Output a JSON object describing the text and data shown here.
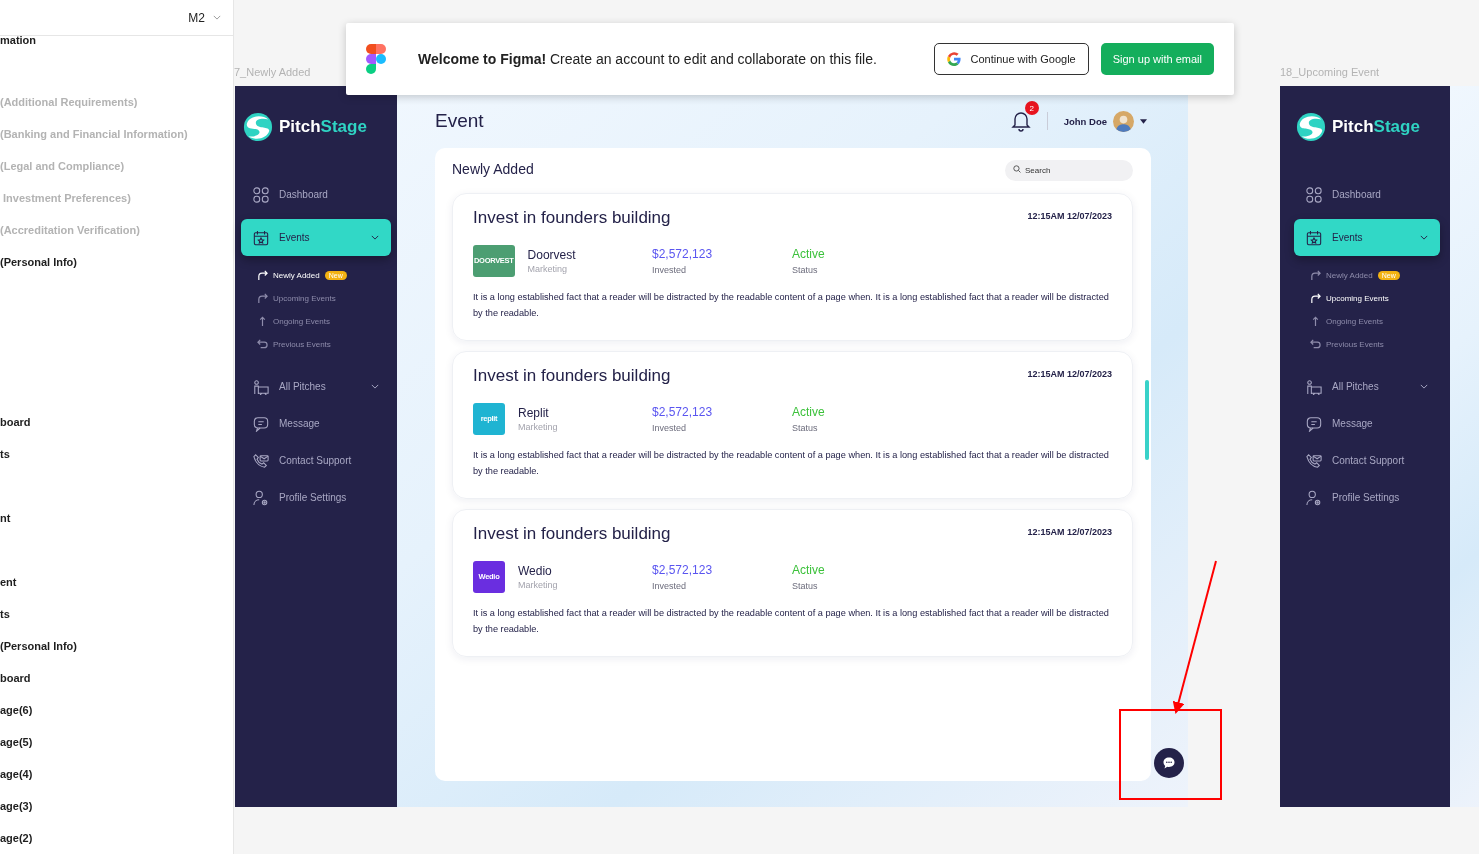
{
  "layers_panel": {
    "page_selector": "M2",
    "layers": [
      {
        "text": "mation",
        "greyed": false
      },
      {
        "text": "(Additional Requirements)",
        "greyed": true
      },
      {
        "text": "(Banking and Financial Information)",
        "greyed": true
      },
      {
        "text": "(Legal and Compliance)",
        "greyed": true
      },
      {
        "text": " Investment Preferences)",
        "greyed": true
      },
      {
        "text": "(Accreditation Verification)",
        "greyed": true
      },
      {
        "text": "(Personal Info)",
        "greyed": false
      },
      {
        "text": "board",
        "greyed": false
      },
      {
        "text": "ts",
        "greyed": false
      },
      {
        "text": "nt",
        "greyed": false
      },
      {
        "text": "ent",
        "greyed": false
      },
      {
        "text": "ts",
        "greyed": false
      },
      {
        "text": "(Personal Info)",
        "greyed": false
      },
      {
        "text": "board",
        "greyed": false
      },
      {
        "text": "age(6)",
        "greyed": false
      },
      {
        "text": "age(5)",
        "greyed": false
      },
      {
        "text": "age(4)",
        "greyed": false
      },
      {
        "text": "age(3)",
        "greyed": false
      },
      {
        "text": "age(2)",
        "greyed": false
      }
    ]
  },
  "frames": [
    {
      "label": "7_Newly Added",
      "sidebar": {
        "brand": [
          "Pitch",
          "Stage"
        ],
        "items": [
          {
            "kind": "dashboard",
            "label": "Dashboard",
            "selected": false
          },
          {
            "kind": "events",
            "label": "Events",
            "selected": true,
            "children": [
              {
                "kind": "forward",
                "label": "Newly Added",
                "badge": "New",
                "selected": true
              },
              {
                "kind": "forward",
                "label": "Upcoming Events",
                "selected": false
              },
              {
                "kind": "up",
                "label": "Ongoing Events",
                "selected": false
              },
              {
                "kind": "back",
                "label": "Previous Events",
                "selected": false
              }
            ]
          },
          {
            "kind": "pitches",
            "label": "All Pitches",
            "selected": false,
            "dropdown": true
          },
          {
            "kind": "message",
            "label": "Message",
            "selected": false
          },
          {
            "kind": "support",
            "label": "Contact Support",
            "selected": false
          },
          {
            "kind": "profile",
            "label": "Profile Settings",
            "selected": false
          }
        ]
      }
    },
    {
      "label": "18_Upcoming Event",
      "sidebar": {
        "brand": [
          "Pitch",
          "Stage"
        ],
        "items": [
          {
            "kind": "dashboard",
            "label": "Dashboard",
            "selected": false
          },
          {
            "kind": "events",
            "label": "Events",
            "selected": true,
            "children": [
              {
                "kind": "forward",
                "label": "Newly Added",
                "badge": "New",
                "selected": false
              },
              {
                "kind": "forward",
                "label": "Upcoming Events",
                "selected": true
              },
              {
                "kind": "up",
                "label": "Ongoing Events",
                "selected": false
              },
              {
                "kind": "back",
                "label": "Previous Events",
                "selected": false
              }
            ]
          },
          {
            "kind": "pitches",
            "label": "All Pitches",
            "selected": false,
            "dropdown": true
          },
          {
            "kind": "message",
            "label": "Message",
            "selected": false
          },
          {
            "kind": "support",
            "label": "Contact Support",
            "selected": false
          },
          {
            "kind": "profile",
            "label": "Profile Settings",
            "selected": false
          }
        ]
      }
    }
  ],
  "event_page": {
    "title": "Event",
    "notifications": "2",
    "user": "John Doe",
    "panel_title": "Newly Added",
    "search": {
      "placeholder": "Search"
    },
    "events": [
      {
        "title": "Invest in founders building",
        "time": "12:15AM 12/07/2023",
        "company": "Doorvest",
        "category": "Marketing",
        "logo_text": "DOORVEST",
        "color": "#4c9e72",
        "amount": "$2,572,123",
        "amount_label": "Invested",
        "status": "Active",
        "status_label": "Status",
        "description": "It is a long established fact that a reader will be distracted by the readable content of a page when. It is a long  established fact that a reader will be distracted by the readable."
      },
      {
        "title": "Invest in founders building",
        "time": "12:15AM 12/07/2023",
        "company": "Replit",
        "category": "Marketing",
        "logo_text": "replit",
        "color": "#1fb4d2",
        "amount": "$2,572,123",
        "amount_label": "Invested",
        "status": "Active",
        "status_label": "Status",
        "description": "It is a long established fact that a reader will be distracted by the readable content of a page when. It is a long  established fact that a reader will be distracted by the readable."
      },
      {
        "title": "Invest in founders building",
        "time": "12:15AM 12/07/2023",
        "company": "Wedio",
        "category": "Marketing",
        "logo_text": "Wedio",
        "color": "#6a2ee0",
        "amount": "$2,572,123",
        "amount_label": "Invested",
        "status": "Active",
        "status_label": "Status",
        "description": "It is a long established fact that a reader will be distracted by the readable content of a page when. It is a long  established fact that a reader will be distracted by the readable."
      }
    ]
  },
  "figma_banner": {
    "message": "**Welcome to Figma!** Create an account to edit and collaborate on this file.",
    "google_button": "Continue with Google",
    "email_button": "Sign up with email"
  }
}
